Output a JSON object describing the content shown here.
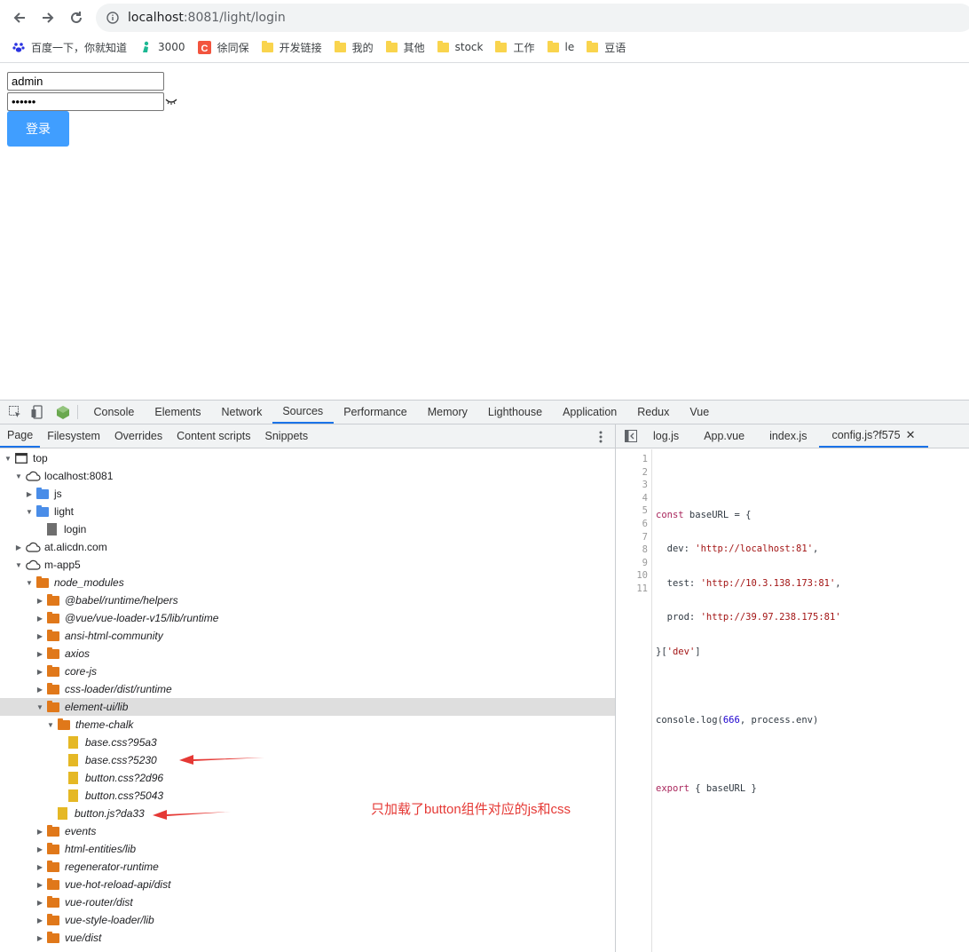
{
  "browser": {
    "url_host": "localhost",
    "url_rest": ":8081/light/login",
    "bookmarks": [
      "百度一下，你就知道",
      "3000",
      "徐同保",
      "开发链接",
      "我的",
      "其他",
      "stock",
      "工作",
      "le",
      "豆语"
    ]
  },
  "page": {
    "username_value": "admin",
    "password_value": "••••••",
    "login_label": "登录"
  },
  "devtools": {
    "main_tabs": [
      "Console",
      "Elements",
      "Network",
      "Sources",
      "Performance",
      "Memory",
      "Lighthouse",
      "Application",
      "Redux",
      "Vue"
    ],
    "active_main_tab": "Sources",
    "nav_tabs": [
      "Page",
      "Filesystem",
      "Overrides",
      "Content scripts",
      "Snippets"
    ],
    "active_nav_tab": "Page",
    "editor_tabs": [
      "log.js",
      "App.vue",
      "index.js",
      "config.js?f575"
    ],
    "active_editor_tab": "config.js?f575",
    "tree": [
      {
        "label": "top",
        "depth": 0,
        "icon": "frame",
        "open": true
      },
      {
        "label": "localhost:8081",
        "depth": 1,
        "icon": "cloud",
        "open": true
      },
      {
        "label": "js",
        "depth": 2,
        "icon": "folder-blue",
        "open": false
      },
      {
        "label": "light",
        "depth": 2,
        "icon": "folder-blue",
        "open": true
      },
      {
        "label": "login",
        "depth": 3,
        "icon": "file-gray",
        "leaf": true
      },
      {
        "label": "at.alicdn.com",
        "depth": 1,
        "icon": "cloud",
        "open": false
      },
      {
        "label": "m-app5",
        "depth": 1,
        "icon": "cloud",
        "open": true
      },
      {
        "label": "node_modules",
        "depth": 2,
        "icon": "folder",
        "open": true,
        "italic": true
      },
      {
        "label": "@babel/runtime/helpers",
        "depth": 3,
        "icon": "folder",
        "open": false,
        "italic": true
      },
      {
        "label": "@vue/vue-loader-v15/lib/runtime",
        "depth": 3,
        "icon": "folder",
        "open": false,
        "italic": true
      },
      {
        "label": "ansi-html-community",
        "depth": 3,
        "icon": "folder",
        "open": false,
        "italic": true
      },
      {
        "label": "axios",
        "depth": 3,
        "icon": "folder",
        "open": false,
        "italic": true
      },
      {
        "label": "core-js",
        "depth": 3,
        "icon": "folder",
        "open": false,
        "italic": true
      },
      {
        "label": "css-loader/dist/runtime",
        "depth": 3,
        "icon": "folder",
        "open": false,
        "italic": true
      },
      {
        "label": "element-ui/lib",
        "depth": 3,
        "icon": "folder",
        "open": true,
        "italic": true,
        "selected": true
      },
      {
        "label": "theme-chalk",
        "depth": 4,
        "icon": "folder",
        "open": true,
        "italic": true
      },
      {
        "label": "base.css?95a3",
        "depth": 5,
        "icon": "file-yellow",
        "leaf": true,
        "italic": true
      },
      {
        "label": "base.css?5230",
        "depth": 5,
        "icon": "file-yellow",
        "leaf": true,
        "italic": true
      },
      {
        "label": "button.css?2d96",
        "depth": 5,
        "icon": "file-yellow",
        "leaf": true,
        "italic": true
      },
      {
        "label": "button.css?5043",
        "depth": 5,
        "icon": "file-yellow",
        "leaf": true,
        "italic": true
      },
      {
        "label": "button.js?da33",
        "depth": 4,
        "icon": "file-yellow",
        "leaf": true,
        "italic": true
      },
      {
        "label": "events",
        "depth": 3,
        "icon": "folder",
        "open": false,
        "italic": true
      },
      {
        "label": "html-entities/lib",
        "depth": 3,
        "icon": "folder",
        "open": false,
        "italic": true
      },
      {
        "label": "regenerator-runtime",
        "depth": 3,
        "icon": "folder",
        "open": false,
        "italic": true
      },
      {
        "label": "vue-hot-reload-api/dist",
        "depth": 3,
        "icon": "folder",
        "open": false,
        "italic": true
      },
      {
        "label": "vue-router/dist",
        "depth": 3,
        "icon": "folder",
        "open": false,
        "italic": true
      },
      {
        "label": "vue-style-loader/lib",
        "depth": 3,
        "icon": "folder",
        "open": false,
        "italic": true
      },
      {
        "label": "vue/dist",
        "depth": 3,
        "icon": "folder",
        "open": false,
        "italic": true
      }
    ],
    "line_numbers": [
      "1",
      "2",
      "3",
      "4",
      "5",
      "6",
      "7",
      "8",
      "9",
      "10",
      "11"
    ],
    "code": {
      "l2_kw": "const",
      "l2_rest": " baseURL = {",
      "l3_key": "  dev: ",
      "l3_str": "'http://localhost:81'",
      "l3_end": ",",
      "l4_key": "  test: ",
      "l4_str": "'http://10.3.138.173:81'",
      "l4_end": ",",
      "l5_key": "  prod: ",
      "l5_str": "'http://39.97.238.175:81'",
      "l6_a": "}[",
      "l6_str": "'dev'",
      "l6_b": "]",
      "l8_a": "console.log(",
      "l8_num": "666",
      "l8_b": ", process.env)",
      "l10_kw": "export",
      "l10_rest": " { baseURL }"
    }
  },
  "annotation": {
    "note": "只加载了button组件对应的js和css"
  }
}
